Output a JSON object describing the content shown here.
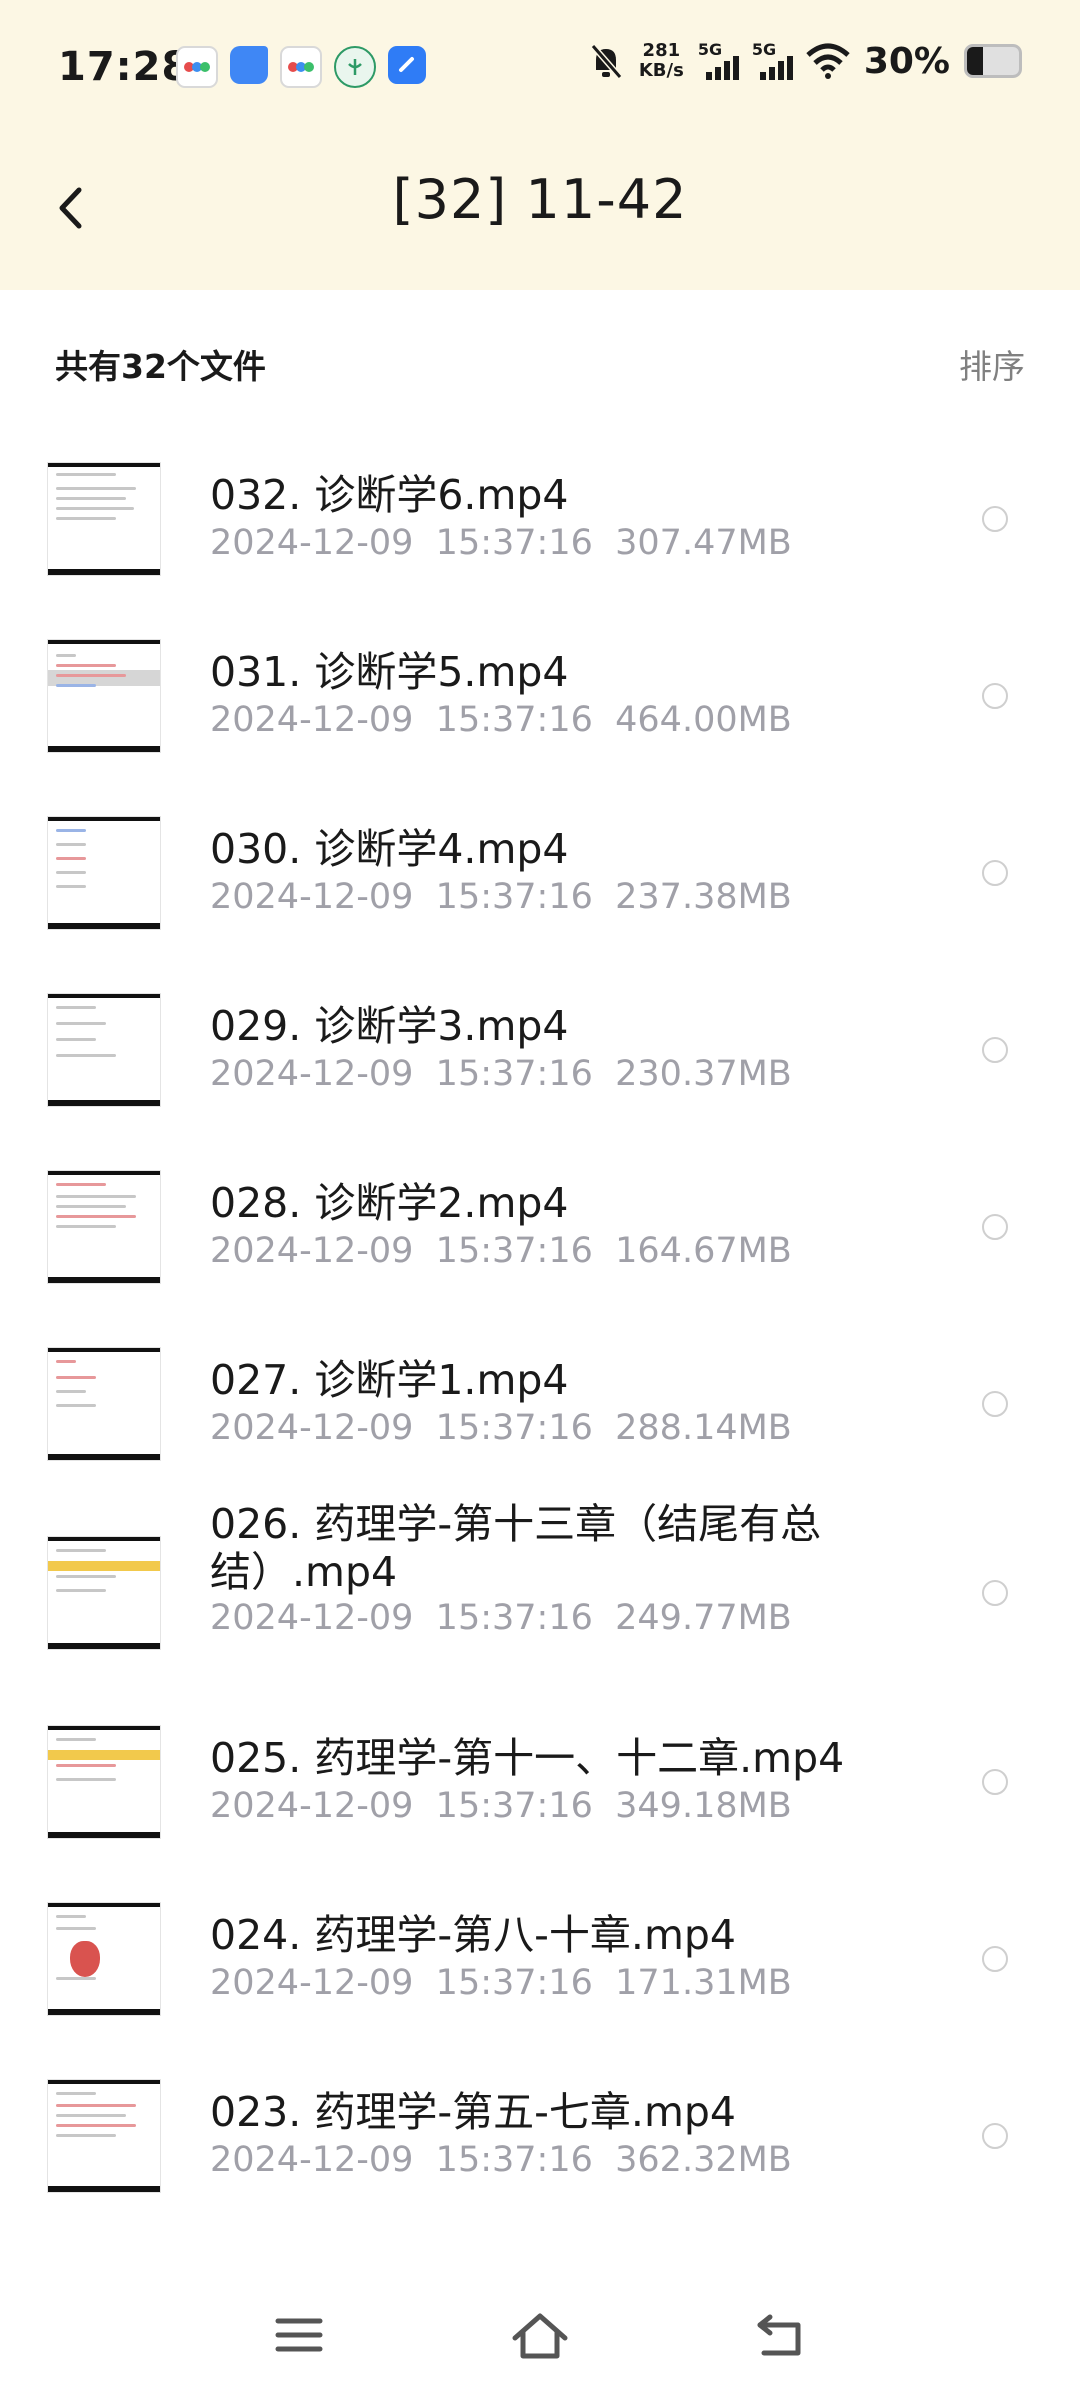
{
  "status_bar": {
    "time": "17:28",
    "net_speed_value": "281",
    "net_speed_unit": "KB/s",
    "sim1_tag": "5G",
    "sim2_tag": "5G",
    "battery_percent": "30%",
    "battery_level": 0.3
  },
  "header": {
    "title": "[32] 11-42",
    "back_icon": "chevron-left-icon"
  },
  "summary": {
    "count_text": "共有32个文件",
    "sort_label": "排序"
  },
  "files": [
    {
      "name": "032.  诊断学6.mp4",
      "date": "2024-12-09",
      "time": "15:37:16",
      "size": "307.47MB"
    },
    {
      "name": "031.  诊断学5.mp4",
      "date": "2024-12-09",
      "time": "15:37:16",
      "size": "464.00MB"
    },
    {
      "name": "030.  诊断学4.mp4",
      "date": "2024-12-09",
      "time": "15:37:16",
      "size": "237.38MB"
    },
    {
      "name": "029.  诊断学3.mp4",
      "date": "2024-12-09",
      "time": "15:37:16",
      "size": "230.37MB"
    },
    {
      "name": "028.  诊断学2.mp4",
      "date": "2024-12-09",
      "time": "15:37:16",
      "size": "164.67MB"
    },
    {
      "name": "027.  诊断学1.mp4",
      "date": "2024-12-09",
      "time": "15:37:16",
      "size": "288.14MB"
    },
    {
      "name": "026.  药理学-第十三章（结尾有总结）.mp4",
      "date": "2024-12-09",
      "time": "15:37:16",
      "size": "249.77MB"
    },
    {
      "name": "025.  药理学-第十一、十二章.mp4",
      "date": "2024-12-09",
      "time": "15:37:16",
      "size": "349.18MB"
    },
    {
      "name": "024.  药理学-第八-十章.mp4",
      "date": "2024-12-09",
      "time": "15:37:16",
      "size": "171.31MB"
    },
    {
      "name": "023.  药理学-第五-七章.mp4",
      "date": "2024-12-09",
      "time": "15:37:16",
      "size": "362.32MB"
    }
  ],
  "nav": {
    "menu_icon": "menu-icon",
    "home_icon": "home-icon",
    "back_icon": "return-icon"
  },
  "colors": {
    "header_bg": "#fcf7e4",
    "meta_text": "#a0a0a8",
    "sort_text": "#808080"
  }
}
